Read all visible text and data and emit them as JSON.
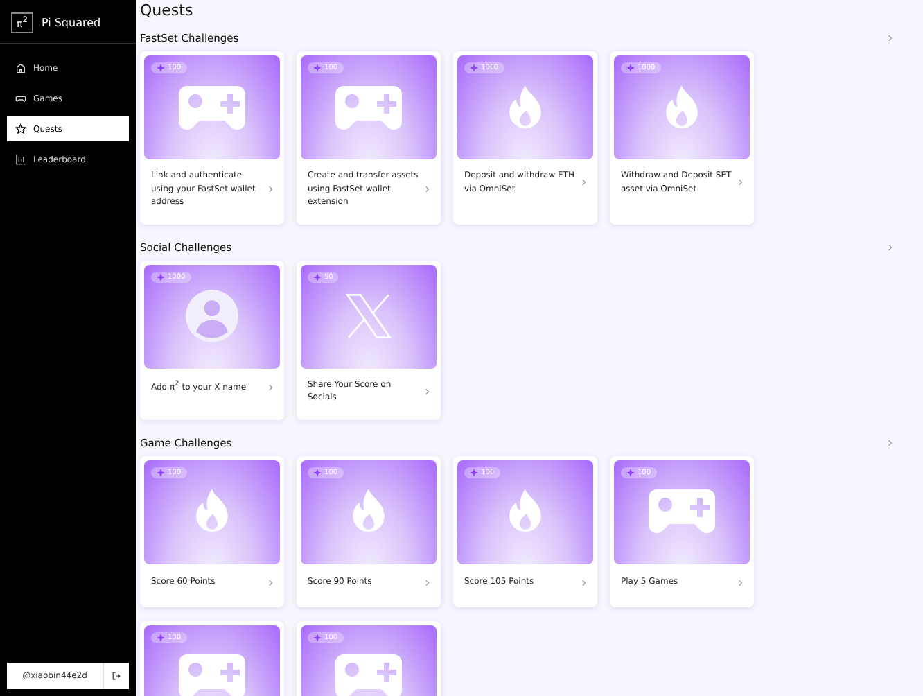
{
  "sidebar": {
    "logo_mark": "π$^{2}$",
    "brand": "Pi Squared",
    "items": [
      {
        "label": "Home",
        "kind": "home",
        "selected": false
      },
      {
        "label": "Games",
        "kind": "gamepad",
        "selected": false
      },
      {
        "label": "Quests",
        "kind": "star",
        "selected": true
      },
      {
        "label": "Leaderboard",
        "kind": "chart",
        "selected": false
      }
    ],
    "user": "@xiaobin44e2d"
  },
  "title": "Quests",
  "sections": [
    {
      "title": "FastSet Challenges",
      "cards": [
        {
          "points": "100",
          "kind": "gamepad",
          "title": "Link and authenticate using your FastSet wallet address"
        },
        {
          "points": "100",
          "kind": "gamepad",
          "title": "Create and transfer assets using FastSet wallet extension"
        },
        {
          "points": "1000",
          "kind": "flame",
          "title": "Deposit and withdraw ETH via OmniSet"
        },
        {
          "points": "1000",
          "kind": "flame",
          "title": "Withdraw and Deposit SET asset via OmniSet"
        }
      ]
    },
    {
      "title": "Social Challenges",
      "cards": [
        {
          "points": "1000",
          "kind": "person",
          "title": "Add π$^{2}$ to your X name"
        },
        {
          "points": "50",
          "kind": "x",
          "title": "Share Your Score on Socials"
        }
      ]
    },
    {
      "title": "Game Challenges",
      "cards": [
        {
          "points": "100",
          "kind": "flame",
          "title": "Score 60 Points"
        },
        {
          "points": "100",
          "kind": "flame",
          "title": "Score 90 Points"
        },
        {
          "points": "100",
          "kind": "flame",
          "title": "Score 105 Points"
        },
        {
          "points": "100",
          "kind": "gamepad",
          "title": "Play 5 Games"
        },
        {
          "points": "100",
          "kind": "gamepad"
        },
        {
          "points": "100",
          "kind": "gamepad"
        }
      ]
    }
  ]
}
